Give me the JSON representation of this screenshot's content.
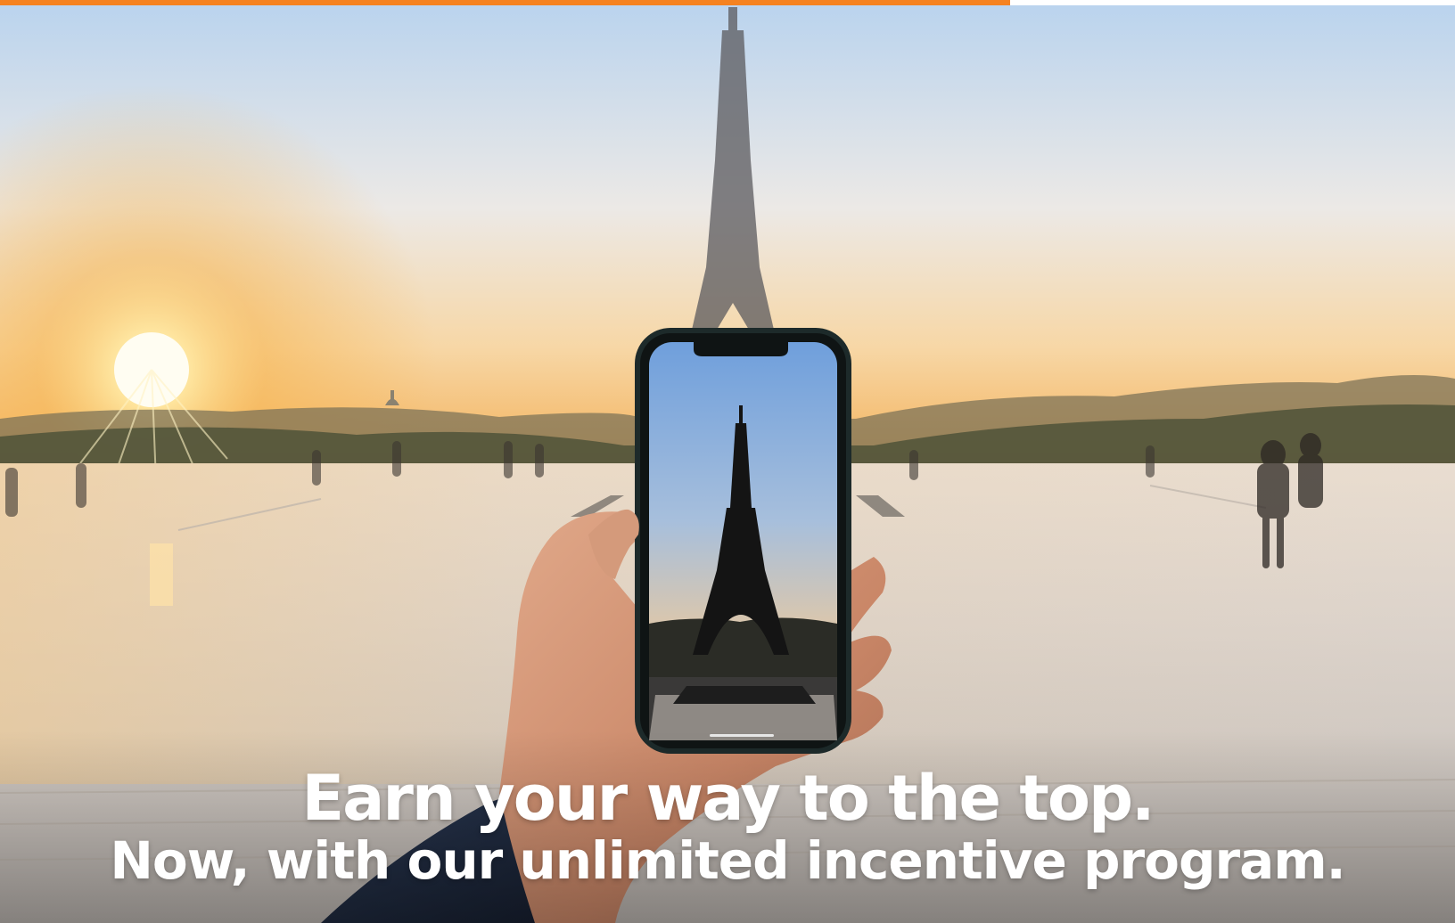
{
  "progress": {
    "value": 0.694,
    "color": "#f58220"
  },
  "hero": {
    "headline": "Earn your way to the top.",
    "subheadline": "Now, with our unlimited incentive program."
  }
}
